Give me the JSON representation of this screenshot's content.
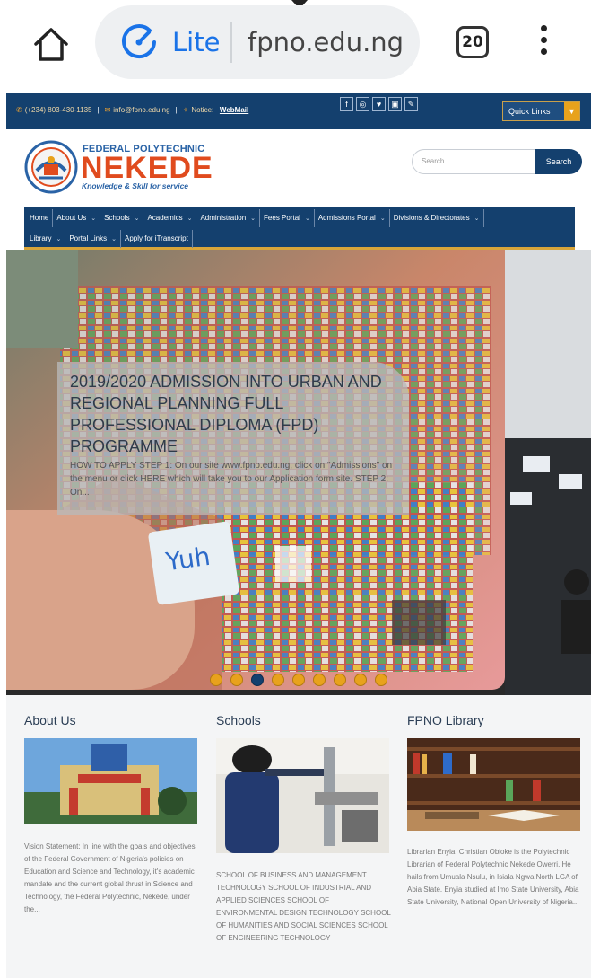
{
  "browser": {
    "site_mode": "Lite",
    "url": "fpno.edu.ng",
    "tab_count": "20"
  },
  "topbar": {
    "phone": "(+234) 803-430-1135",
    "email": "info@fpno.edu.ng",
    "notice_label": "Notice:",
    "webmail": "WebMail",
    "social_icons": [
      "facebook-icon",
      "instagram-icon",
      "twitter-icon",
      "youtube-icon",
      "link-icon"
    ],
    "quick_links": "Quick Links"
  },
  "header": {
    "logo_small": "FEDERAL POLYTECHNIC",
    "logo_big": "NEKEDE",
    "logo_tagline": "Knowledge & Skill for service",
    "search_placeholder": "Search...",
    "search_button": "Search"
  },
  "nav": {
    "row1": [
      {
        "label": "Home",
        "dropdown": false
      },
      {
        "label": "About Us",
        "dropdown": true
      },
      {
        "label": "Schools",
        "dropdown": true
      },
      {
        "label": "Academics",
        "dropdown": true
      },
      {
        "label": "Administration",
        "dropdown": true
      },
      {
        "label": "Fees Portal",
        "dropdown": true
      },
      {
        "label": "Admissions Portal",
        "dropdown": true
      },
      {
        "label": "Divisions & Directorates",
        "dropdown": true
      }
    ],
    "row2": [
      {
        "label": "Library",
        "dropdown": true
      },
      {
        "label": "Portal Links",
        "dropdown": true
      },
      {
        "label": "Apply for iTranscript",
        "dropdown": false
      }
    ]
  },
  "slider": {
    "title": "2019/2020 ADMISSION INTO URBAN AND REGIONAL PLANNING FULL PROFESSIONAL DIPLOMA (FPD) PROGRAMME",
    "excerpt": "HOW TO APPLY STEP 1: On our site www.fpno.edu.ng, click on \"Admissions\" on the menu or click HERE which will take you to our Application form site. STEP 2: On...",
    "cube_text": "Yuh",
    "dot_count": 9,
    "active_dot": 3
  },
  "columns": {
    "about": {
      "title": "About Us",
      "text": "Vision Statement: In line with the goals and objectives of the Federal Government of Nigeria's policies on Education and Science and Technology, it's academic mandate and the current global thrust in Science and Technology, the Federal Polytechnic, Nekede, under the..."
    },
    "schools": {
      "title": "Schools",
      "text": "SCHOOL OF BUSINESS AND MANAGEMENT TECHNOLOGY SCHOOL OF INDUSTRIAL AND APPLIED SCIENCES SCHOOL OF ENVIRONMENTAL DESIGN TECHNOLOGY SCHOOL OF HUMANITIES AND SOCIAL SCIENCES SCHOOL OF ENGINEERING TECHNOLOGY"
    },
    "library": {
      "title": "FPNO Library",
      "text": "Librarian Enyia, Christian Obioke is the Polytechnic Librarian of Federal Polytechnic Nekede Owerri. He hails from Umuala Nsulu, in Isiala Ngwa North LGA of Abia State. Enyia studied at Imo State University, Abia State University, National Open University of Nigeria..."
    }
  },
  "colors": {
    "navy": "#14406e",
    "accent_orange": "#e8a21c",
    "logo_red": "#e04b1e",
    "logo_blue": "#2a63a6"
  }
}
